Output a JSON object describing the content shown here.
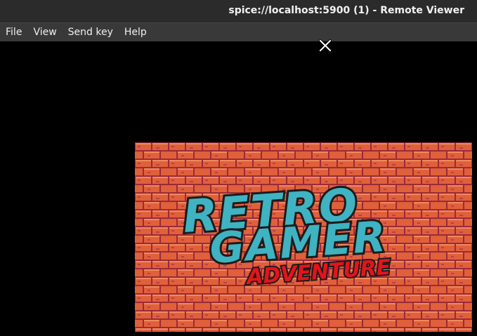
{
  "window": {
    "title": "spice://localhost:5900 (1) - Remote Viewer"
  },
  "menu": {
    "items": [
      "File",
      "View",
      "Send key",
      "Help"
    ]
  },
  "game": {
    "logo_line1": "RETRO",
    "logo_line2": "GAMER",
    "logo_line3": "ADVENTURE"
  },
  "colors": {
    "titlebar_bg": "#2b2b2b",
    "menubar_bg": "#393939",
    "brick": "#e0603a",
    "mortar": "#9a2a3a",
    "logo_fill": "#3fb3c2",
    "logo_outline": "#1b1b1b",
    "subtitle_fill": "#e3141b"
  },
  "icons": {
    "cursor": "x-cursor-icon"
  }
}
